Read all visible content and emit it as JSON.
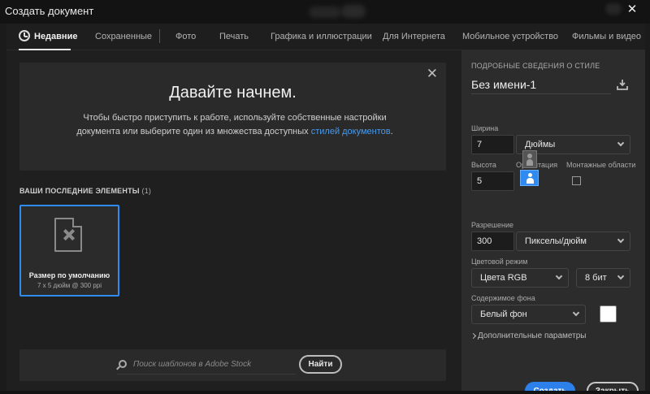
{
  "window": {
    "title": "Создать документ",
    "close_glyph": "✕"
  },
  "tabs": [
    {
      "label": "Недавние",
      "active": true
    },
    {
      "label": "Сохраненные"
    },
    {
      "label": "Фото"
    },
    {
      "label": "Печать"
    },
    {
      "label": "Графика и иллюстрации"
    },
    {
      "label": "Для Интернета"
    },
    {
      "label": "Мобильное устройство"
    },
    {
      "label": "Фильмы и видео"
    }
  ],
  "welcome": {
    "title": "Давайте начнем.",
    "text": "Чтобы быстро приступить к работе, используйте собственные настройки документа или выберите один из множества доступных",
    "link": "стилей документов",
    "suffix": ".",
    "close_glyph": "✕"
  },
  "recent": {
    "title": "ВАШИ ПОСЛЕДНИЕ ЭЛЕМЕНТЫ",
    "count": "(1)",
    "items": [
      {
        "name": "Размер по умолчанию",
        "meta": "7 x 5 дюйм @ 300 ppi",
        "icon": "document-pen-icon"
      }
    ]
  },
  "stock": {
    "placeholder": "Поиск шаблонов в Adobe Stock",
    "find_label": "Найти"
  },
  "details": {
    "section_title": "ПОДРОБНЫЕ СВЕДЕНИЯ О СТИЛЕ",
    "doc_name": "Без имени-1",
    "width_label": "Ширина",
    "width_value": "7",
    "width_unit": "Дюймы",
    "height_label": "Высота",
    "height_value": "5",
    "orientation_label": "Ориентация",
    "artboards_label": "Монтажные области",
    "resolution_label": "Разрешение",
    "resolution_value": "300",
    "resolution_unit": "Пикселы/дюйм",
    "color_mode_label": "Цветовой режим",
    "color_mode_value": "Цвета RGB",
    "bit_depth": "8 бит",
    "background_label": "Содержимое фона",
    "background_value": "Белый фон",
    "background_color": "#ffffff",
    "advanced_label": "Дополнительные параметры",
    "create_label": "Создать",
    "close_label": "Закрыть"
  },
  "colors": {
    "accent": "#2f8bf1",
    "create_button": "#2d7fe9"
  }
}
